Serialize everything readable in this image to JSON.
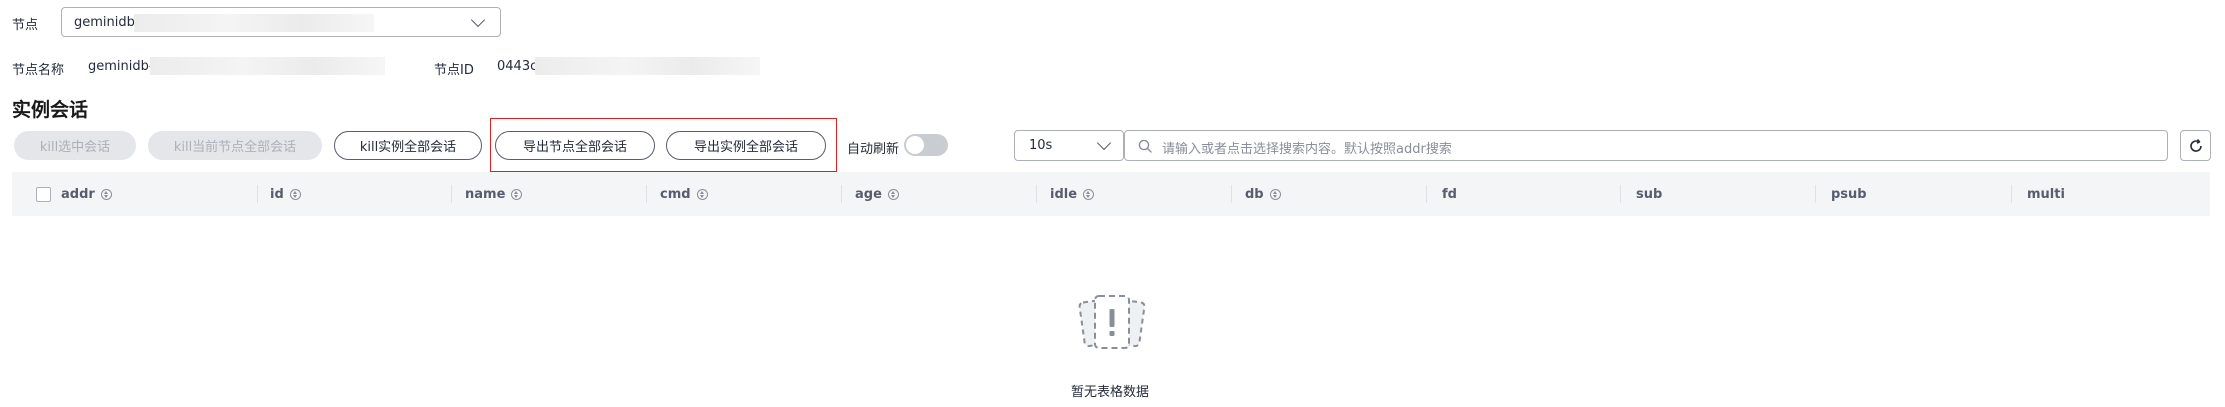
{
  "node_selector": {
    "label": "节点",
    "value": "geminidb-"
  },
  "node_info": {
    "name_label": "节点名称",
    "name_value": "geminidb-",
    "id_label": "节点ID",
    "id_value": "0443c"
  },
  "section_title": "实例会话",
  "toolbar": {
    "kill_selected": "kill选中会话",
    "kill_current_node_all": "kill当前节点全部会话",
    "kill_instance_all": "kill实例全部会话",
    "export_node_all": "导出节点全部会话",
    "export_instance_all": "导出实例全部会话",
    "auto_refresh_label": "自动刷新",
    "auto_refresh_on": false,
    "interval_value": "10s",
    "search_placeholder": "请输入或者点击选择搜索内容。默认按照addr搜索"
  },
  "table": {
    "columns": [
      {
        "label": "addr",
        "sortable": true
      },
      {
        "label": "id",
        "sortable": true
      },
      {
        "label": "name",
        "sortable": true
      },
      {
        "label": "cmd",
        "sortable": true
      },
      {
        "label": "age",
        "sortable": true
      },
      {
        "label": "idle",
        "sortable": true
      },
      {
        "label": "db",
        "sortable": true
      },
      {
        "label": "fd",
        "sortable": false
      },
      {
        "label": "sub",
        "sortable": false
      },
      {
        "label": "psub",
        "sortable": false
      },
      {
        "label": "multi",
        "sortable": false
      }
    ],
    "rows": [],
    "empty_text": "暂无表格数据"
  },
  "colors": {
    "highlight_border": "#e02020",
    "header_bg": "#f4f5f7"
  },
  "icons": {
    "search": "search-icon",
    "refresh": "refresh-icon",
    "empty": "empty-data-icon",
    "dropdown": "chevron-down-icon"
  }
}
